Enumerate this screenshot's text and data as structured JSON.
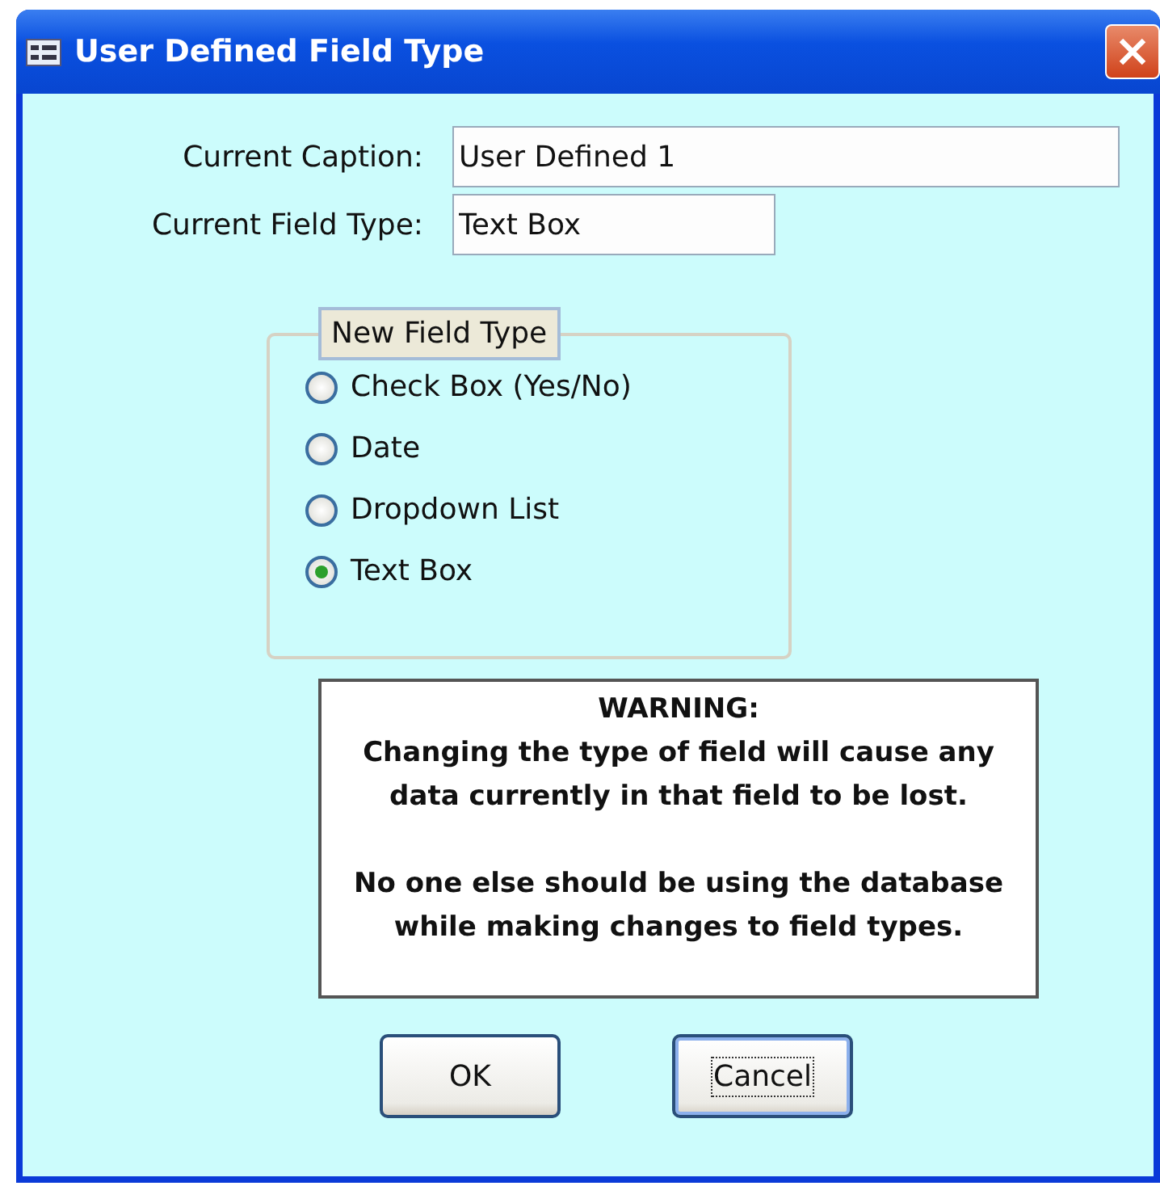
{
  "window": {
    "title": "User Defined Field Type"
  },
  "fields": [
    {
      "label": "Current Caption:",
      "value": "User Defined 1",
      "kind": "wide"
    },
    {
      "label": "Current Field Type:",
      "value": "Text Box",
      "kind": "narrow"
    }
  ],
  "group": {
    "legend": "New Field Type",
    "options": [
      {
        "label": "Check Box (Yes/No)",
        "selected": false
      },
      {
        "label": "Date",
        "selected": false
      },
      {
        "label": "Dropdown List",
        "selected": false
      },
      {
        "label": "Text Box",
        "selected": true
      }
    ]
  },
  "warning": {
    "title": "WARNING:",
    "paragraphs": [
      "Changing the type of field will cause any\ndata currently in that field to be lost.",
      "No one else should be using the database\nwhile making changes to field types."
    ]
  },
  "buttons": [
    {
      "label": "OK",
      "focused": false
    },
    {
      "label": "Cancel",
      "focused": true
    }
  ]
}
